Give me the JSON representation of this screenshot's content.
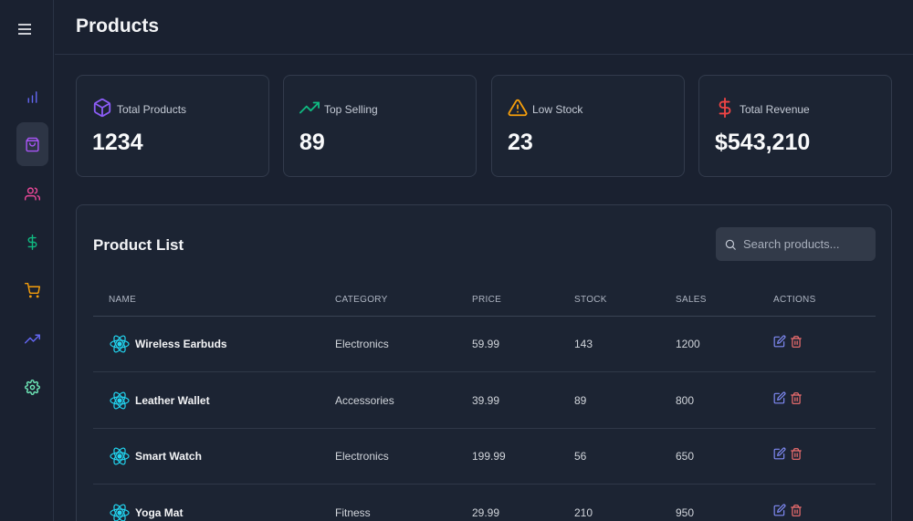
{
  "header": {
    "title": "Products"
  },
  "sidebar": {
    "items": [
      {
        "icon": "bar-chart-icon",
        "color": "#6366f1"
      },
      {
        "icon": "shopping-bag-icon",
        "color": "#a855f7",
        "active": true
      },
      {
        "icon": "users-icon",
        "color": "#ec4899"
      },
      {
        "icon": "dollar-icon",
        "color": "#10b981"
      },
      {
        "icon": "shopping-cart-icon",
        "color": "#f59e0b"
      },
      {
        "icon": "trending-up-icon",
        "color": "#6366f1"
      },
      {
        "icon": "settings-icon",
        "color": "#6ee7b7"
      }
    ]
  },
  "stats": [
    {
      "label": "Total Products",
      "value": "1234",
      "icon": "package-icon",
      "color": "#8b5cf6"
    },
    {
      "label": "Top Selling",
      "value": "89",
      "icon": "trending-up-icon",
      "color": "#10b981"
    },
    {
      "label": "Low Stock",
      "value": "23",
      "icon": "alert-triangle-icon",
      "color": "#f59e0b"
    },
    {
      "label": "Total Revenue",
      "value": "$543,210",
      "icon": "dollar-sign-icon",
      "color": "#ef4444"
    }
  ],
  "product_list": {
    "title": "Product List",
    "search_placeholder": "Search products...",
    "columns": [
      "NAME",
      "CATEGORY",
      "PRICE",
      "STOCK",
      "SALES",
      "ACTIONS"
    ],
    "rows": [
      {
        "name": "Wireless Earbuds",
        "category": "Electronics",
        "price": "59.99",
        "stock": "143",
        "sales": "1200"
      },
      {
        "name": "Leather Wallet",
        "category": "Accessories",
        "price": "39.99",
        "stock": "89",
        "sales": "800"
      },
      {
        "name": "Smart Watch",
        "category": "Electronics",
        "price": "199.99",
        "stock": "56",
        "sales": "650"
      },
      {
        "name": "Yoga Mat",
        "category": "Fitness",
        "price": "29.99",
        "stock": "210",
        "sales": "950"
      }
    ]
  },
  "colors": {
    "edit": "#818cf8",
    "delete": "#f87171",
    "product_icon": "#22d3ee"
  }
}
